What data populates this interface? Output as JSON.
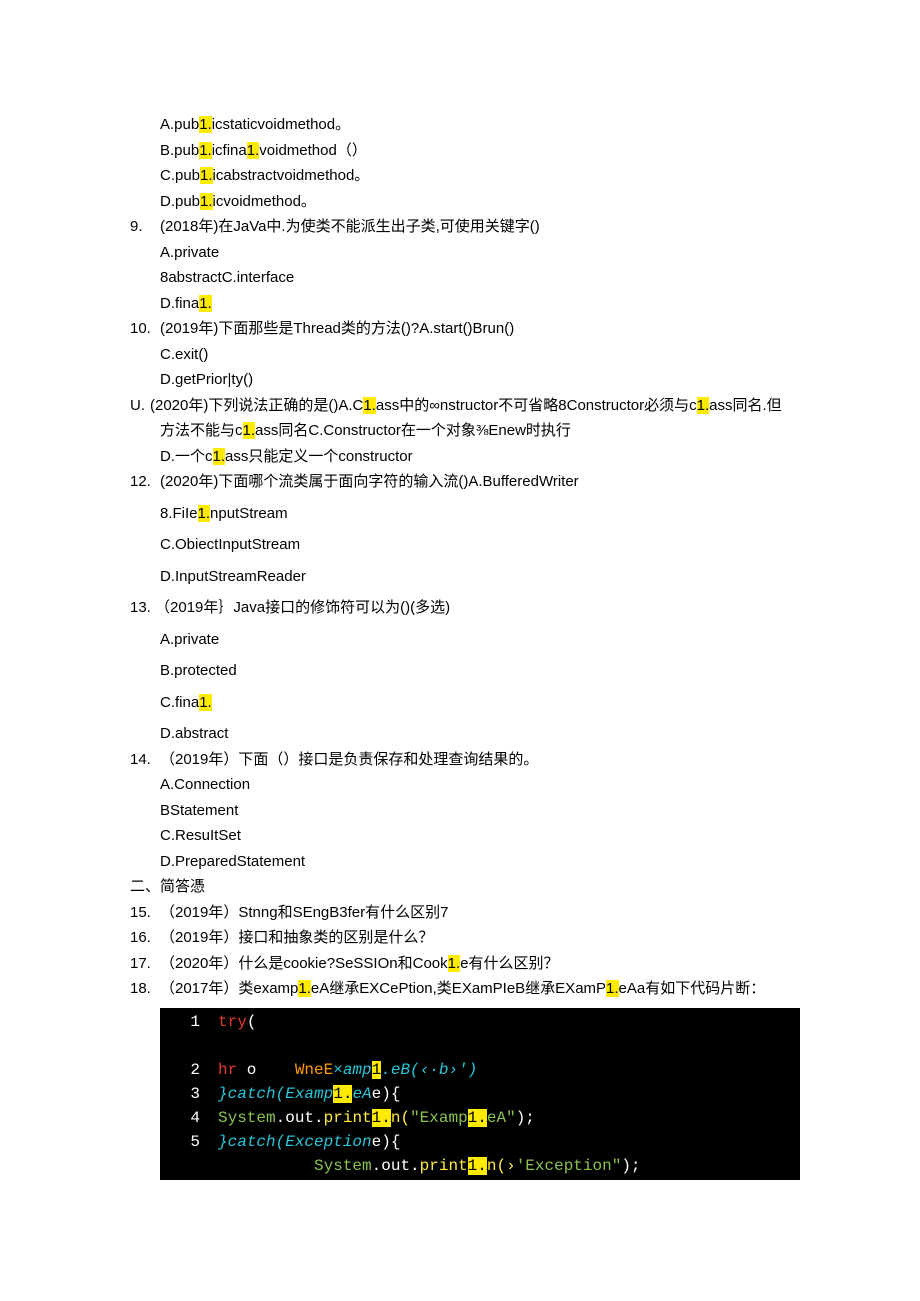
{
  "q8": {
    "a_pre": "A.pub",
    "a_h": "1.",
    "a_post": "icstaticvoidmethod。",
    "b_pre": "B.pub",
    "b_h1": "1.",
    "b_mid": "icfina",
    "b_h2": "1.",
    "b_post": "voidmethod（）",
    "c_pre": "C.pub",
    "c_h": "1.",
    "c_post": "icabstractvoidmethod。",
    "d_pre": "D.pub",
    "d_h": "1.",
    "d_post": "icvoidmethod。"
  },
  "q9": {
    "num": "9.",
    "text": "(2018年)在JaVa中.为使类不能派生出子类,可使用关键字()",
    "a": "A.private",
    "b": "8abstractC.interface",
    "d_pre": "D.fina",
    "d_h": "1."
  },
  "q10": {
    "num": "10.",
    "text": "(2019年)下面那些是Thread类的方法()?A.start()Brun()",
    "c": "C.exit()",
    "d": "D.getPrior|ty()"
  },
  "qU": {
    "num": "U.",
    "t1_pre": "(2020年)下列说法正确的是()A.C",
    "t1_h1": "1.",
    "t1_mid": "ass中的∞nstructor不可省略8Constructor必须与c",
    "t1_h2": "1.",
    "t1_post": "ass同名.但",
    "t2_pre": "方法不能与c",
    "t2_h": "1.",
    "t2_post": "ass同名C.Constructor在一个对象⅜Enew时执行",
    "t3_pre": "D.一个c",
    "t3_h": "1.",
    "t3_post": "ass只能定义一个constructor"
  },
  "q12": {
    "num": "12.",
    "text": "(2020年)下面哪个流类属于面向字符的输入流()A.BufferedWriter",
    "b_pre": "8.FiIe",
    "b_h": "1.",
    "b_post": "nputStream",
    "c": "C.ObiectInputStream",
    "d": "D.InputStreamReader"
  },
  "q13": {
    "num": "13.",
    "text": "（2019年｝Java接口的修饰符可以为()(多选)",
    "a": "A.private",
    "b": "B.protected",
    "c_pre": "C.fina",
    "c_h": "1.",
    "d": "D.abstract"
  },
  "q14": {
    "num": "14.",
    "text": "（2019年）下面（）接口是负责保存和处理查询结果的。",
    "a": "A.Connection",
    "b": "BStatement",
    "c": "C.ResuItSet",
    "d": "D.PreparedStatement"
  },
  "sec2": "二、简答憑",
  "q15": {
    "num": "15.",
    "text": "（2019年）Stnng和SEngB3fer有什么区别7"
  },
  "q16": {
    "num": "16.",
    "text": "（2019年）接口和抽象类的区别是什么？"
  },
  "q17": {
    "num": "17.",
    "t_pre": "（2020年）什么是cookie?SeSSIOn和Cook",
    "t_h": "1.",
    "t_post": "e有什么区别？"
  },
  "q18": {
    "num": "18.",
    "t_pre": "（2017年）类examp",
    "t_h1": "1.",
    "t_mid": "eA继承EXCePtion,类EXamPIeB继承EXamP",
    "t_h2": "1.",
    "t_post": "eAa有如下代码片断："
  },
  "code": {
    "l1": {
      "n": "1",
      "try": "try",
      "brace": "("
    },
    "l2": {
      "n": "2",
      "hr": "hr",
      "o": " o",
      "wne": "WneE",
      "xamp": "×amp",
      "h": "1",
      "eb": ".eB(",
      "arg": "‹·b›'",
      "close": ")"
    },
    "l3": {
      "n": "3",
      "brace": "}",
      "catch": "catch(Examp",
      "h": "1.",
      "ea": "eA",
      "e": "e",
      "close": "){"
    },
    "l4": {
      "n": "4",
      "sys": "System",
      "dot1": ".",
      "out": "out",
      "dot2": ".",
      "print": "print",
      "h": "1.",
      "n2": "n(",
      "str": "\"Examp",
      "strh": "1.",
      "str2": "eA\"",
      "end": ");"
    },
    "l5": {
      "n": "5",
      "brace": "}",
      "catch": "catch(Exception",
      "e": "e",
      "close": "){"
    },
    "l6": {
      "sp": "          ",
      "sys": "System",
      "dot1": ".",
      "out": "out",
      "dot2": ".",
      "print": "print",
      "h": "1.",
      "n2": "n(›",
      "str": "'Exception\"",
      "end": ");"
    }
  }
}
